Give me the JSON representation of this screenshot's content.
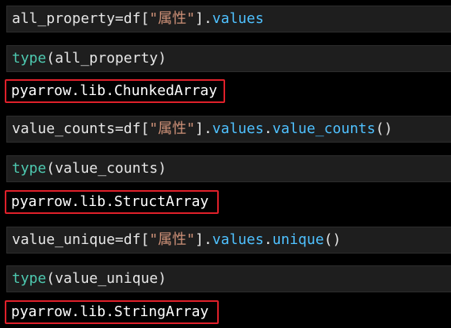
{
  "cells": [
    {
      "code": {
        "var": "all_property",
        "eq": "=",
        "df": "df",
        "lbr": "[",
        "str": "\"属性\"",
        "rbr": "]",
        "dot1": ".",
        "attr": "values"
      }
    },
    {
      "code": {
        "func": "type",
        "lp": "(",
        "arg": "all_property",
        "rp": ")"
      },
      "output": "pyarrow.lib.ChunkedArray"
    },
    {
      "code": {
        "var": "value_counts",
        "eq": "=",
        "df": "df",
        "lbr": "[",
        "str": "\"属性\"",
        "rbr": "]",
        "dot1": ".",
        "attr": "values",
        "dot2": ".",
        "meth": "value_counts",
        "call": "()"
      }
    },
    {
      "code": {
        "func": "type",
        "lp": "(",
        "arg": "value_counts",
        "rp": ")"
      },
      "output": "pyarrow.lib.StructArray"
    },
    {
      "code": {
        "var": "value_unique",
        "eq": "=",
        "df": "df",
        "lbr": "[",
        "str": "\"属性\"",
        "rbr": "]",
        "dot1": ".",
        "attr": "values",
        "dot2": ".",
        "meth": "unique",
        "call": "()"
      }
    },
    {
      "code": {
        "func": "type",
        "lp": "(",
        "arg": "value_unique",
        "rp": ")"
      },
      "output": "pyarrow.lib.StringArray"
    }
  ],
  "colors": {
    "background": "#000000",
    "cell_background": "#1e1e1e",
    "highlight_border": "#e0202a",
    "string": "#ce9178",
    "attribute": "#4fc1ff",
    "builtin": "#4ec9b0"
  }
}
